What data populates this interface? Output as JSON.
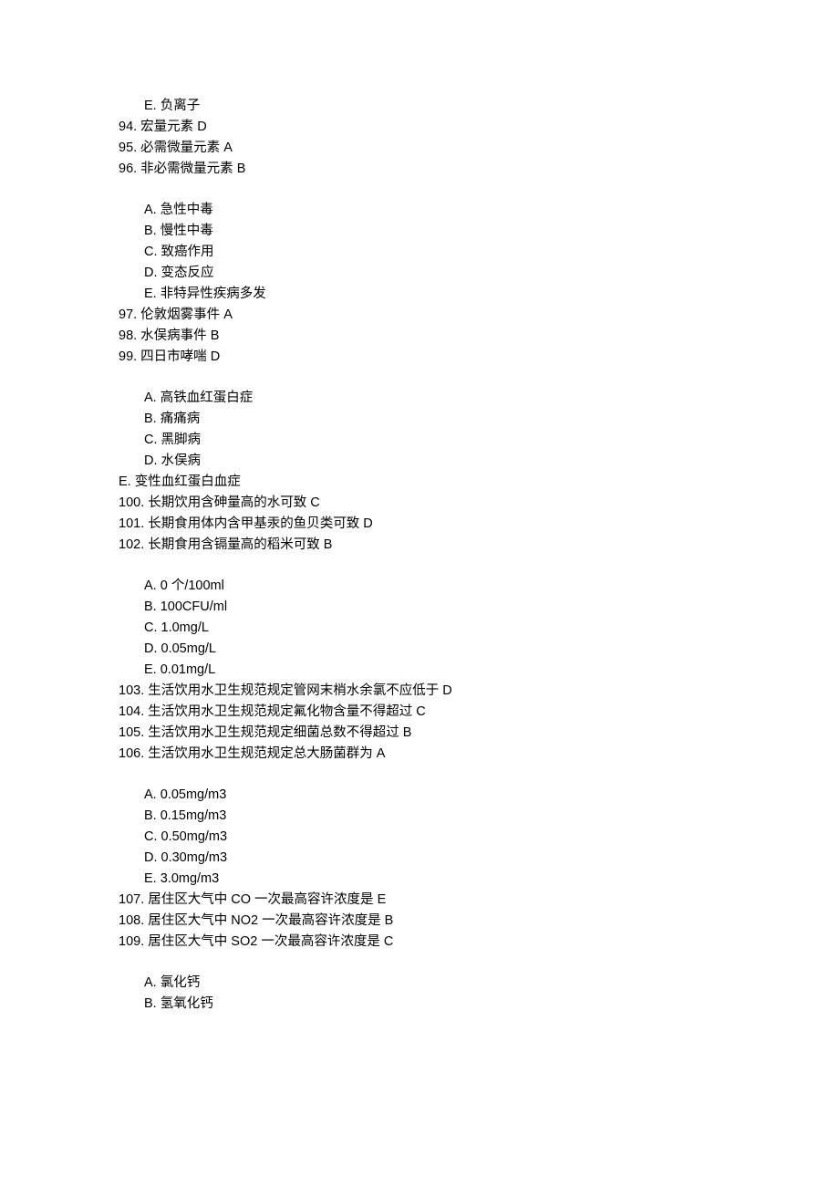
{
  "blocks": [
    {
      "type": "group",
      "options": [
        {
          "indent": 1,
          "text": "E. 负离子"
        }
      ],
      "questions": [
        {
          "text": "94. 宏量元素 D"
        },
        {
          "text": "95. 必需微量元素 A"
        },
        {
          "text": "96. 非必需微量元素 B"
        }
      ]
    },
    {
      "type": "group",
      "options": [
        {
          "indent": 1,
          "text": "A. 急性中毒"
        },
        {
          "indent": 1,
          "text": "B. 慢性中毒"
        },
        {
          "indent": 1,
          "text": "C. 致癌作用"
        },
        {
          "indent": 1,
          "text": "D. 变态反应"
        },
        {
          "indent": 1,
          "text": "E. 非特异性疾病多发"
        }
      ],
      "questions": [
        {
          "text": "97. 伦敦烟雾事件 A"
        },
        {
          "text": "98. 水俣病事件 B"
        },
        {
          "text": "99. 四日市哮喘 D"
        }
      ]
    },
    {
      "type": "group",
      "options": [
        {
          "indent": 1,
          "text": "A. 高铁血红蛋白症"
        },
        {
          "indent": 1,
          "text": "B. 痛痛病"
        },
        {
          "indent": 1,
          "text": "C. 黑脚病"
        },
        {
          "indent": 1,
          "text": "D. 水俣病"
        },
        {
          "indent": 0,
          "text": "E. 变性血红蛋白血症"
        }
      ],
      "questions": [
        {
          "text": "100. 长期饮用含砷量高的水可致 C"
        },
        {
          "text": "101. 长期食用体内含甲基汞的鱼贝类可致 D"
        },
        {
          "text": "102. 长期食用含镉量高的稻米可致 B"
        }
      ]
    },
    {
      "type": "group",
      "options": [
        {
          "indent": 1,
          "text": "A. 0 个/100ml"
        },
        {
          "indent": 1,
          "text": "B. 100CFU/ml"
        },
        {
          "indent": 1,
          "text": "C. 1.0mg/L"
        },
        {
          "indent": 1,
          "text": "D. 0.05mg/L"
        },
        {
          "indent": 1,
          "text": "E. 0.01mg/L"
        }
      ],
      "questions": [
        {
          "text": "103. 生活饮用水卫生规范规定管网末梢水余氯不应低于 D"
        },
        {
          "text": "104. 生活饮用水卫生规范规定氟化物含量不得超过 C"
        },
        {
          "text": "105. 生活饮用水卫生规范规定细菌总数不得超过 B"
        },
        {
          "text": "106. 生活饮用水卫生规范规定总大肠菌群为 A"
        }
      ]
    },
    {
      "type": "group",
      "options": [
        {
          "indent": 1,
          "text": "A. 0.05mg/m3"
        },
        {
          "indent": 1,
          "text": "B. 0.15mg/m3"
        },
        {
          "indent": 1,
          "text": "C. 0.50mg/m3"
        },
        {
          "indent": 1,
          "text": "D. 0.30mg/m3"
        },
        {
          "indent": 1,
          "text": "E. 3.0mg/m3"
        }
      ],
      "questions": [
        {
          "text": "107. 居住区大气中 CO 一次最高容许浓度是 E"
        },
        {
          "text": "108. 居住区大气中 NO2 一次最高容许浓度是 B"
        },
        {
          "text": "109. 居住区大气中 SO2 一次最高容许浓度是 C"
        }
      ]
    },
    {
      "type": "group",
      "options": [
        {
          "indent": 1,
          "text": "A. 氯化钙"
        },
        {
          "indent": 1,
          "text": "B. 氢氧化钙"
        }
      ],
      "questions": []
    }
  ]
}
